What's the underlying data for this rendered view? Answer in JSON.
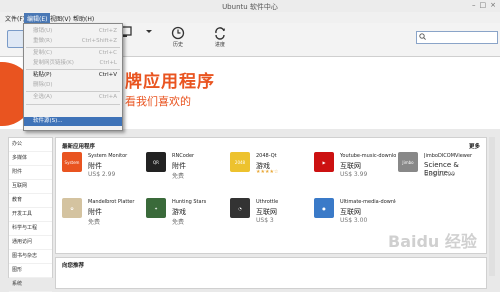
{
  "window": {
    "title": "Ubuntu 软件中心"
  },
  "menubar": {
    "items": [
      "文件(F)",
      "编辑(E)",
      "视图(V)",
      "帮助(H)"
    ]
  },
  "toolbar": {
    "history_label": "历史",
    "progress_label": "进度"
  },
  "search": {
    "value": "",
    "placeholder": ""
  },
  "banner": {
    "line1": "牌应用程序",
    "line2": "看我们喜欢的"
  },
  "edit_menu": {
    "items": [
      {
        "label": "撤销(U)",
        "shortcut": "Ctrl+Z",
        "enabled": false
      },
      {
        "label": "重做(R)",
        "shortcut": "Ctrl+Shift+Z",
        "enabled": false
      },
      {
        "label": "复制(C)",
        "shortcut": "Ctrl+C",
        "enabled": false
      },
      {
        "label": "复制网页链接(K)",
        "shortcut": "Ctrl+L",
        "enabled": false
      },
      {
        "label": "粘贴(P)",
        "shortcut": "Ctrl+V",
        "enabled": true
      },
      {
        "label": "删除(D)",
        "shortcut": "",
        "enabled": false
      },
      {
        "label": "全选(A)",
        "shortcut": "Ctrl+A",
        "enabled": false
      },
      {
        "label": "软件源(S)...",
        "shortcut": "",
        "enabled": true,
        "highlighted": true
      }
    ]
  },
  "sidebar": {
    "items": [
      "办公",
      "多媒体",
      "附件",
      "互联网",
      "教育",
      "开发工具",
      "科学与工程",
      "通用访问",
      "图书与杂志",
      "图形",
      "系统"
    ]
  },
  "featured": {
    "title": "最新应用程序",
    "more": "更多",
    "apps": [
      {
        "name": "System Monitor",
        "category": "附件",
        "price": "US$ 2.99",
        "icon_label": "System",
        "color": "#e95420"
      },
      {
        "name": "RNCoder",
        "category": "附件",
        "price": "免费",
        "icon_label": "QR",
        "color": "#222222"
      },
      {
        "name": "2048-Qt",
        "category": "游戏",
        "price": "免费",
        "icon_label": "2048",
        "color": "#edc22e",
        "stars": "★★★★☆"
      },
      {
        "name": "Youtube-music-download...",
        "category": "互联网",
        "price": "US$ 3.99",
        "icon_label": "▶",
        "color": "#cc1111"
      },
      {
        "name": "JimboDICOMViewer",
        "category": "Science & Engine...",
        "price": "US$ 29.99",
        "icon_label": "Jimbo",
        "color": "#888888"
      },
      {
        "name": "Mandelbrot Platter",
        "category": "附件",
        "price": "免费",
        "icon_label": "✿",
        "color": "#d4c3a0"
      },
      {
        "name": "Hunting Stars",
        "category": "游戏",
        "price": "免费",
        "icon_label": "✦",
        "color": "#3a6a3a"
      },
      {
        "name": "Uthrottle",
        "category": "互联网",
        "price": "US$ 3",
        "icon_label": "◔",
        "color": "#333333"
      },
      {
        "name": "Ultimate-media-downloa...",
        "category": "互联网",
        "price": "US$ 3.00",
        "icon_label": "●",
        "color": "#3a7ac8"
      }
    ]
  },
  "recommended": {
    "title": "向您推荐"
  },
  "watermark": "Baidu 经验"
}
